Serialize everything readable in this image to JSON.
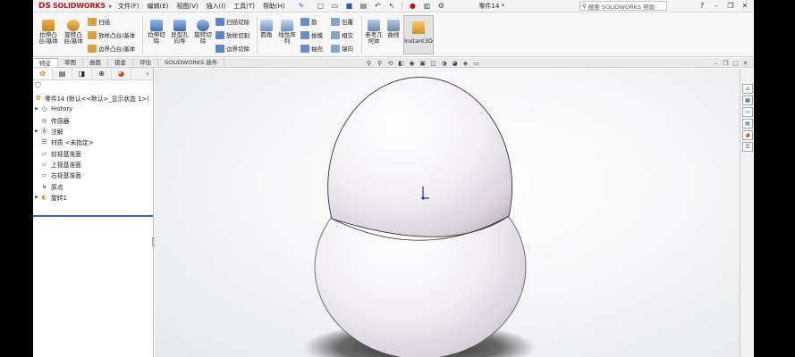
{
  "app": {
    "logo_ds": "DS",
    "logo_name": "SOLIDWORKS",
    "document_title": "零件14 *",
    "search_placeholder": "搜索 SOLIDWORKS 帮助",
    "accent_color": "#c0141a"
  },
  "menu": [
    "文件(F)",
    "编辑(E)",
    "视图(V)",
    "插入(I)",
    "工具(T)",
    "帮助(H)"
  ],
  "ribbon": {
    "extrude_boss": "拉伸凸\n台/基体",
    "revolve_boss": "旋转凸\n台/基体",
    "sweep_boss": "扫描",
    "loft_boss": "放样凸台/基体",
    "boundary_boss": "边界凸台/基体",
    "extrude_cut": "拉伸切\n除",
    "hole_wizard": "异型孔\n向导",
    "revolve_cut": "旋转切\n除",
    "sweep_cut": "扫描切除",
    "loft_cut": "放样切割",
    "boundary_cut": "边界切除",
    "fillet": "圆角",
    "linear_pattern": "线性阵\n列",
    "rib": "筋",
    "draft": "拔模",
    "shell": "抽壳",
    "wrap": "包覆",
    "intersect": "相交",
    "mirror": "镜向",
    "ref_geometry": "参考几\n何体",
    "curves": "曲线",
    "instant3d": "Instant3D"
  },
  "tabs": [
    "特征",
    "草图",
    "曲面",
    "钣金",
    "评估",
    "SOLIDWORKS 插件"
  ],
  "feature_tree": {
    "root": "零件14 (默认<<默认>_显示状态 1>)",
    "items": [
      {
        "label": "History",
        "expandable": true
      },
      {
        "label": "传感器",
        "expandable": false
      },
      {
        "label": "注解",
        "expandable": true
      },
      {
        "label": "材质 <未指定>",
        "expandable": false
      },
      {
        "label": "前视基准面",
        "expandable": false
      },
      {
        "label": "上视基准面",
        "expandable": false
      },
      {
        "label": "右视基准面",
        "expandable": false
      },
      {
        "label": "原点",
        "expandable": false
      },
      {
        "label": "旋转1",
        "expandable": true
      }
    ]
  },
  "colors": {
    "highlight": "#2d6ad6",
    "background": "#ffffff"
  }
}
